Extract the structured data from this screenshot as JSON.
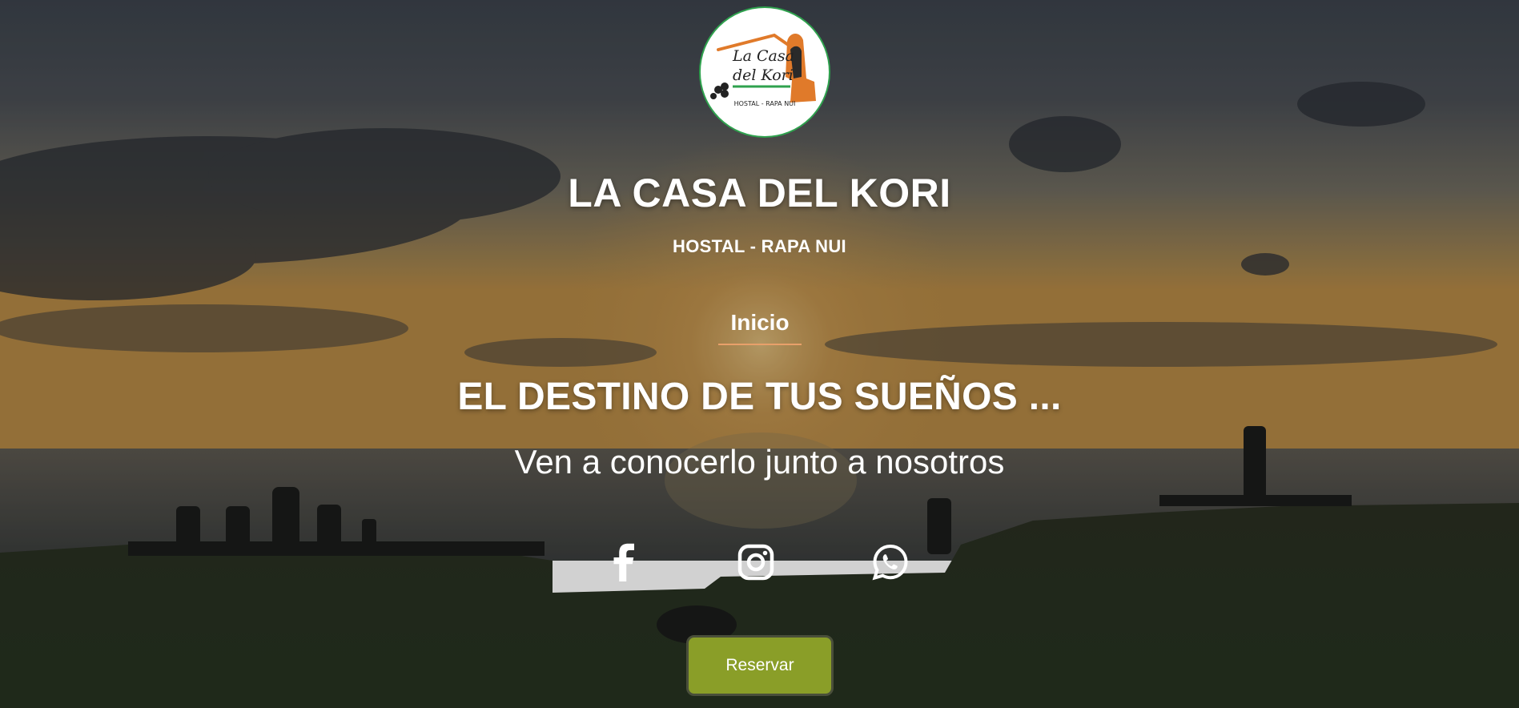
{
  "brand": {
    "logo_script_line1": "La Casa",
    "logo_script_line2": "del Kori",
    "logo_caption": "HOSTAL - RAPA NUI",
    "title": "LA CASA DEL KORI",
    "subtitle": "HOSTAL - RAPA NUI"
  },
  "nav": {
    "active_label": "Inicio"
  },
  "hero": {
    "headline": "EL DESTINO DE TUS SUEÑOS ...",
    "tagline": "Ven a conocerlo junto a nosotros"
  },
  "social": [
    {
      "icon": "facebook-icon"
    },
    {
      "icon": "instagram-icon"
    },
    {
      "icon": "whatsapp-icon"
    }
  ],
  "cta": {
    "reserve_label": "Reservar"
  },
  "colors": {
    "accent_button": "#8a9e28",
    "nav_underline": "#e8a06a",
    "logo_ring": "#2fa24e",
    "logo_orange": "#e07a2a"
  }
}
